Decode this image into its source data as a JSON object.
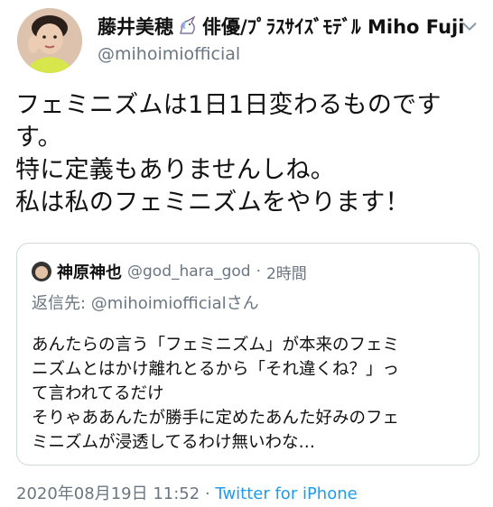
{
  "author": {
    "display_name_prefix": "藤井美穂",
    "display_name_suffix": "俳優/ﾌﾟﾗｽｻｲｽﾞﾓﾃﾞﾙ Miho Fuji",
    "handle": "@mihoimiofficial",
    "name_icon": "unicorn-icon",
    "menu_icon": "chevron-down-icon"
  },
  "tweet": {
    "lines": [
      "フェミニズムは1日1日変わるものです",
      "す。",
      "特に定義もありませんしね。",
      "私は私のフェミニズムをやります！"
    ]
  },
  "quoted": {
    "display_name": "神原神也",
    "handle": "@god_hara_god",
    "separator": "·",
    "time": "2時間",
    "reply_prefix": "返信先: ",
    "reply_mention": "@mihoimiofficial",
    "reply_suffix": "さん",
    "lines": [
      "あんたらの言う「フェミニズム」が本来のフェミ",
      "ニズムとはかけ離れとるから「それ違くね？」っ",
      "て言われてるだけ",
      "そりゃああんたが勝手に定めたあんた好みのフェ",
      "ミニズムが浸透してるわけ無いわな…"
    ]
  },
  "footer": {
    "timestamp": "2020年08月19日 11:52",
    "separator": "·",
    "source": "Twitter for iPhone"
  },
  "colors": {
    "text": "#111111",
    "secondary": "#6b7680",
    "link": "#1d9bf0",
    "border": "#cfd9de"
  }
}
